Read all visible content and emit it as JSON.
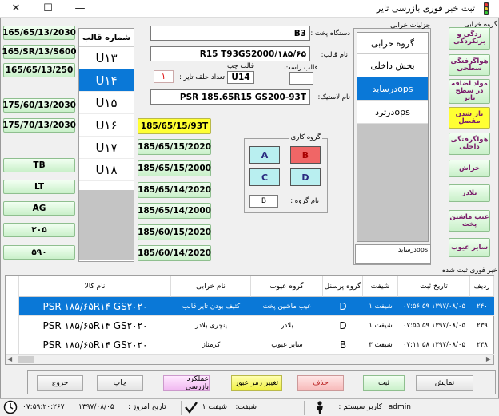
{
  "window": {
    "title": "ثبت خبر فوری بازرسی تایر"
  },
  "left_sizes": [
    "165/65/13/2030",
    "165/SR/13/S600",
    "165/65/13/250",
    "175/60/13/2030",
    "175/70/13/2030"
  ],
  "left_types": [
    "TB",
    "LT",
    "AG",
    "۲۰۵",
    "۵۹۰"
  ],
  "mold": {
    "header": "شماره قالب",
    "items": [
      "U۱۳",
      "U۱۴",
      "U۱۵",
      "U۱۶",
      "U۱۷",
      "U۱۸"
    ],
    "selected_index": 1
  },
  "center_sizes": [
    "185/65/15/93T",
    "185/65/15/2020",
    "185/65/15/2000",
    "185/65/14/2020",
    "185/65/14/2000",
    "185/60/15/2020",
    "185/60/14/2020"
  ],
  "form": {
    "device_label": "دستگاه پخت :",
    "device_value": "B3",
    "mold_name_label": "نام قالب:",
    "mold_name_value": "R15 T93GS2000/۱۸۵/۶۵",
    "left_mold_label": "قالب چپ",
    "left_mold_value": "U14",
    "right_mold_label": "قالب راست",
    "right_mold_value": "",
    "ring_count_label": "تعداد حلقه تایر :",
    "ring_count_value": "۱",
    "tire_name_label": "نام لاستیک:",
    "tire_name_value": "PSR 185.65R15 GS200-93T"
  },
  "work_group": {
    "title": "گروه کاری",
    "buttons": [
      "A",
      "B",
      "C",
      "D"
    ],
    "selected": "B",
    "group_name_label": "نام گروه :",
    "group_name_value": "B"
  },
  "defect_details": {
    "title": "جزئیات خرابی",
    "header": "گروه خرابی",
    "items": [
      {
        "text": "بخش داخلی",
        "selected": false
      },
      {
        "text": "opsدرساید",
        "selected": true
      },
      {
        "text": "opsدرترد",
        "selected": false
      }
    ],
    "note": "درسایدops"
  },
  "defect_group": {
    "title": "گروه خرابی",
    "items": [
      "ردگی و برنکردگی",
      "هواگرفتگی سطحی",
      "مواد اضافه در سطح تایر",
      "باز شدن مفصل",
      "هواگرفتگی داخلی",
      "خراش",
      "بلادر",
      "عیب ماشین پخت",
      "سایر عیوب"
    ],
    "active_index": 3
  },
  "records": {
    "title": "خبر فوری ثبت شده",
    "columns": [
      "ردیف",
      "تاریخ ثبت",
      "شیفت",
      "گروه پرسنل",
      "گروه عیوب",
      "نام خرابی",
      "نام کالا"
    ],
    "rows": [
      {
        "row": "۲۴۰",
        "date": "۱۳۹۷/۰۸/۰۵ ۰۷:۵۶:۵۹",
        "shift": "شیفت ۱",
        "crew": "D",
        "defect_group": "عیب ماشین پخت",
        "defect": "کثیف بودن تایر قالب",
        "product": "PSR ۱۸۵/۶۵R۱۴ GS۲۰۲۰",
        "selected": true
      },
      {
        "row": "۲۳۹",
        "date": "۱۳۹۷/۰۸/۰۵ ۰۷:۵۵:۵۹",
        "shift": "شیفت ۱",
        "crew": "D",
        "defect_group": "بلادر",
        "defect": "پنچری بلادر",
        "product": "PSR ۱۸۵/۶۵R۱۴ GS۲۰۲۰",
        "selected": false
      },
      {
        "row": "۲۳۸",
        "date": "۱۳۹۷/۰۸/۰۵ ۰۷:۱۱:۵۸",
        "shift": "شیفت ۳",
        "crew": "B",
        "defect_group": "سایر عیوب",
        "defect": "کرمناز",
        "product": "PSR ۱۸۵/۶۵R۱۴ GS۲۰۲۰",
        "selected": false
      }
    ]
  },
  "actions": {
    "show": "نمایش",
    "save": "ثبت",
    "delete": "حذف",
    "change_pass": "تغییر رمز عبور",
    "inspector_perf": "عملکرد بازرسی",
    "print": "چاپ",
    "exit": "خروج"
  },
  "status": {
    "user_label": "کاربر سیستم :",
    "user_value": "admin",
    "shift_label": "شیفت:",
    "shift_value": "شیفت ۱",
    "date_label": "تاریخ امروز :",
    "date_value": "۱۳۹۷/۰۸/۰۵",
    "time_value": "۰۷:۵۹:۲۰:۲۶۷"
  },
  "colors": {
    "accent_blue": "#0a78d7",
    "button_green": "#c9f0c9",
    "yellow_highlight": "#ffff33",
    "group_cyan": "#b9eff0",
    "group_selected_red": "#f06666",
    "title_magenta": "#7a1d6a"
  }
}
